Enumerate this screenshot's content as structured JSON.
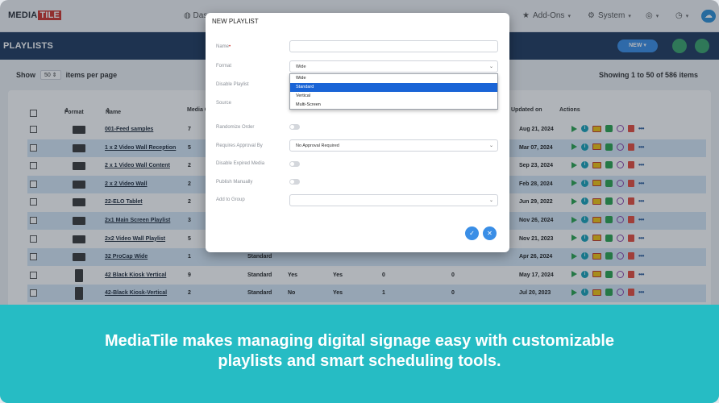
{
  "app": {
    "logo_media": "MEDIA",
    "logo_tile": "TILE"
  },
  "nav": {
    "dashboard": "Das",
    "addons": "Add-Ons",
    "system": "System"
  },
  "header": {
    "title": "PLAYLISTS",
    "new_button": "NEW"
  },
  "list": {
    "show_label": "Show",
    "per_page": "50",
    "per_page_suffix": "items per page",
    "showing": "Showing 1 to 50 of 586 items"
  },
  "table": {
    "headers": {
      "format": "Format",
      "name": "Name",
      "media": "Media C",
      "updated": "Updated on",
      "actions": "Actions"
    },
    "rows": [
      {
        "name": "001-Feed samples",
        "media": "7",
        "format": "",
        "disabled": "",
        "source": "",
        "c1": "",
        "c2": "",
        "date": "Aug 21, 2024",
        "vertical": false,
        "alt": false
      },
      {
        "name": "1 x 2 Video Wall Reception",
        "media": "5",
        "format": "",
        "disabled": "",
        "source": "",
        "c1": "",
        "c2": "",
        "date": "Mar 07, 2024",
        "vertical": false,
        "alt": true
      },
      {
        "name": "2 x 1 Video Wall Content",
        "media": "2",
        "format": "",
        "disabled": "",
        "source": "",
        "c1": "",
        "c2": "",
        "date": "Sep 23, 2024",
        "vertical": false,
        "alt": false
      },
      {
        "name": "2 x 2 Video Wall",
        "media": "2",
        "format": "",
        "disabled": "",
        "source": "",
        "c1": "",
        "c2": "",
        "date": "Feb 28, 2024",
        "vertical": false,
        "alt": true
      },
      {
        "name": "22-ELO Tablet",
        "media": "2",
        "format": "",
        "disabled": "",
        "source": "",
        "c1": "",
        "c2": "",
        "date": "Jun 29, 2022",
        "vertical": false,
        "alt": false
      },
      {
        "name": "2x1 Main Screen Playlist",
        "media": "3",
        "format": "",
        "disabled": "",
        "source": "",
        "c1": "",
        "c2": "",
        "date": "Nov 26, 2024",
        "vertical": false,
        "alt": true
      },
      {
        "name": "2x2 Video Wall Playlist",
        "media": "5",
        "format": "",
        "disabled": "",
        "source": "",
        "c1": "",
        "c2": "",
        "date": "Nov 21, 2023",
        "vertical": false,
        "alt": false
      },
      {
        "name": "32 ProCap Wide",
        "media": "1",
        "format": "Standard",
        "disabled": "",
        "source": "",
        "c1": "",
        "c2": "",
        "date": "Apr 26, 2024",
        "vertical": false,
        "alt": true
      },
      {
        "name": "42 Black Kiosk Vertical",
        "media": "9",
        "format": "Standard",
        "disabled": "Yes",
        "source": "Yes",
        "c1": "0",
        "c2": "0",
        "date": "May 17, 2024",
        "vertical": true,
        "alt": false
      },
      {
        "name": "42-Black Kiosk-Vertical",
        "media": "2",
        "format": "Standard",
        "disabled": "No",
        "source": "Yes",
        "c1": "1",
        "c2": "0",
        "date": "Jul 20, 2023",
        "vertical": true,
        "alt": true
      }
    ]
  },
  "modal": {
    "title": "NEW PLAYLIST",
    "name_label": "Name",
    "name_value": "",
    "format_label": "Format",
    "format_value": "Wide",
    "format_options": [
      "Wide",
      "Standard",
      "Vertical",
      "Multi-Screen"
    ],
    "format_selected_index": 1,
    "disable_label": "Disable Playlist",
    "source_label": "Source",
    "randomize_label": "Randomize Order",
    "approval_label": "Requires Approval By",
    "approval_value": "No Approval Required",
    "expired_label": "Disable Expired Media",
    "publish_label": "Publish Manually",
    "group_label": "Add to Group",
    "group_value": ""
  },
  "banner": {
    "line1": "MediaTile makes managing digital signage easy with customizable",
    "line2": "playlists and smart scheduling tools."
  },
  "colors": {
    "header": "#1f3a5e",
    "accent": "#3a8ee6",
    "banner": "#26bcc4",
    "row_alt": "#d7e8f7"
  }
}
